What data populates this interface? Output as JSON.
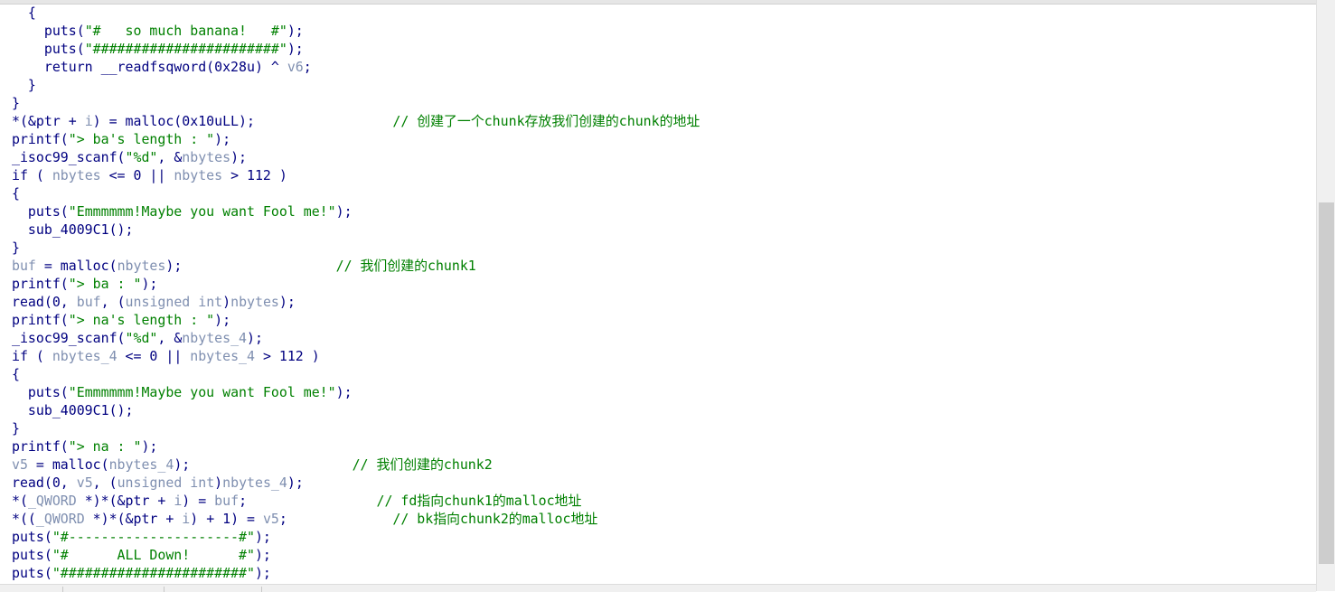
{
  "code": {
    "lines": [
      [
        {
          "t": "  {",
          "c": "code"
        }
      ],
      [
        {
          "t": "    puts(",
          "c": "code"
        },
        {
          "t": "\"#   so much banana!   #\"",
          "c": "str"
        },
        {
          "t": ");",
          "c": "code"
        }
      ],
      [
        {
          "t": "    puts(",
          "c": "code"
        },
        {
          "t": "\"#######################\"",
          "c": "str"
        },
        {
          "t": ");",
          "c": "code"
        }
      ],
      [
        {
          "t": "    return __readfsqword(0x28u) ^ ",
          "c": "code"
        },
        {
          "t": "v6",
          "c": "var"
        },
        {
          "t": ";",
          "c": "code"
        }
      ],
      [
        {
          "t": "  }",
          "c": "code"
        }
      ],
      [
        {
          "t": "}",
          "c": "code"
        }
      ],
      [
        {
          "t": "*(&ptr + ",
          "c": "code"
        },
        {
          "t": "i",
          "c": "var"
        },
        {
          "t": ") = malloc(0x10uLL);                 ",
          "c": "code"
        },
        {
          "t": "// 创建了一个chunk存放我们创建的chunk的地址",
          "c": "cmt"
        }
      ],
      [
        {
          "t": "printf(",
          "c": "code"
        },
        {
          "t": "\"> ba's length : \"",
          "c": "str"
        },
        {
          "t": ");",
          "c": "code"
        }
      ],
      [
        {
          "t": "_isoc99_scanf(",
          "c": "code"
        },
        {
          "t": "\"%d\"",
          "c": "str"
        },
        {
          "t": ", &",
          "c": "code"
        },
        {
          "t": "nbytes",
          "c": "var"
        },
        {
          "t": ");",
          "c": "code"
        }
      ],
      [
        {
          "t": "if ( ",
          "c": "code"
        },
        {
          "t": "nbytes",
          "c": "var"
        },
        {
          "t": " <= 0 || ",
          "c": "code"
        },
        {
          "t": "nbytes",
          "c": "var"
        },
        {
          "t": " > 112 )",
          "c": "code"
        }
      ],
      [
        {
          "t": "{",
          "c": "code"
        }
      ],
      [
        {
          "t": "  puts(",
          "c": "code"
        },
        {
          "t": "\"Emmmmmm!Maybe you want Fool me!\"",
          "c": "str"
        },
        {
          "t": ");",
          "c": "code"
        }
      ],
      [
        {
          "t": "  sub_4009C1();",
          "c": "code"
        }
      ],
      [
        {
          "t": "}",
          "c": "code"
        }
      ],
      [
        {
          "t": "buf",
          "c": "var"
        },
        {
          "t": " = malloc(",
          "c": "code"
        },
        {
          "t": "nbytes",
          "c": "var"
        },
        {
          "t": ");                   ",
          "c": "code"
        },
        {
          "t": "// 我们创建的chunk1",
          "c": "cmt"
        }
      ],
      [
        {
          "t": "printf(",
          "c": "code"
        },
        {
          "t": "\"> ba : \"",
          "c": "str"
        },
        {
          "t": ");",
          "c": "code"
        }
      ],
      [
        {
          "t": "read(0, ",
          "c": "code"
        },
        {
          "t": "buf",
          "c": "var"
        },
        {
          "t": ", (",
          "c": "code"
        },
        {
          "t": "unsigned int",
          "c": "var"
        },
        {
          "t": ")",
          "c": "code"
        },
        {
          "t": "nbytes",
          "c": "var"
        },
        {
          "t": ");",
          "c": "code"
        }
      ],
      [
        {
          "t": "printf(",
          "c": "code"
        },
        {
          "t": "\"> na's length : \"",
          "c": "str"
        },
        {
          "t": ");",
          "c": "code"
        }
      ],
      [
        {
          "t": "_isoc99_scanf(",
          "c": "code"
        },
        {
          "t": "\"%d\"",
          "c": "str"
        },
        {
          "t": ", &",
          "c": "code"
        },
        {
          "t": "nbytes_4",
          "c": "var"
        },
        {
          "t": ");",
          "c": "code"
        }
      ],
      [
        {
          "t": "if ( ",
          "c": "code"
        },
        {
          "t": "nbytes_4",
          "c": "var"
        },
        {
          "t": " <= 0 || ",
          "c": "code"
        },
        {
          "t": "nbytes_4",
          "c": "var"
        },
        {
          "t": " > 112 )",
          "c": "code"
        }
      ],
      [
        {
          "t": "{",
          "c": "code"
        }
      ],
      [
        {
          "t": "  puts(",
          "c": "code"
        },
        {
          "t": "\"Emmmmmm!Maybe you want Fool me!\"",
          "c": "str"
        },
        {
          "t": ");",
          "c": "code"
        }
      ],
      [
        {
          "t": "  sub_4009C1();",
          "c": "code"
        }
      ],
      [
        {
          "t": "}",
          "c": "code"
        }
      ],
      [
        {
          "t": "printf(",
          "c": "code"
        },
        {
          "t": "\"> na : \"",
          "c": "str"
        },
        {
          "t": ");",
          "c": "code"
        }
      ],
      [
        {
          "t": "v5",
          "c": "var"
        },
        {
          "t": " = malloc(",
          "c": "code"
        },
        {
          "t": "nbytes_4",
          "c": "var"
        },
        {
          "t": ");                    ",
          "c": "code"
        },
        {
          "t": "// 我们创建的chunk2",
          "c": "cmt"
        }
      ],
      [
        {
          "t": "read(0, ",
          "c": "code"
        },
        {
          "t": "v5",
          "c": "var"
        },
        {
          "t": ", (",
          "c": "code"
        },
        {
          "t": "unsigned int",
          "c": "var"
        },
        {
          "t": ")",
          "c": "code"
        },
        {
          "t": "nbytes_4",
          "c": "var"
        },
        {
          "t": ");",
          "c": "code"
        }
      ],
      [
        {
          "t": "*(",
          "c": "code"
        },
        {
          "t": "_QWORD",
          "c": "var"
        },
        {
          "t": " *)*(&ptr + ",
          "c": "code"
        },
        {
          "t": "i",
          "c": "var"
        },
        {
          "t": ") = ",
          "c": "code"
        },
        {
          "t": "buf",
          "c": "var"
        },
        {
          "t": ";                ",
          "c": "code"
        },
        {
          "t": "// fd指向chunk1的malloc地址",
          "c": "cmt"
        }
      ],
      [
        {
          "t": "*((",
          "c": "code"
        },
        {
          "t": "_QWORD",
          "c": "var"
        },
        {
          "t": " *)*(&ptr + ",
          "c": "code"
        },
        {
          "t": "i",
          "c": "var"
        },
        {
          "t": ") + 1) = ",
          "c": "code"
        },
        {
          "t": "v5",
          "c": "var"
        },
        {
          "t": ";             ",
          "c": "code"
        },
        {
          "t": "// bk指向chunk2的malloc地址",
          "c": "cmt"
        }
      ],
      [
        {
          "t": "puts(",
          "c": "code"
        },
        {
          "t": "\"#---------------------#\"",
          "c": "str"
        },
        {
          "t": ");",
          "c": "code"
        }
      ],
      [
        {
          "t": "puts(",
          "c": "code"
        },
        {
          "t": "\"#      ALL Down!      #\"",
          "c": "str"
        },
        {
          "t": ");",
          "c": "code"
        }
      ],
      [
        {
          "t": "puts(",
          "c": "code"
        },
        {
          "t": "\"#######################\"",
          "c": "str"
        },
        {
          "t": ");",
          "c": "code"
        }
      ]
    ]
  },
  "colors": {
    "code": "#000080",
    "string": "#008000",
    "variable": "#7f8fb0",
    "comment": "#008000"
  }
}
